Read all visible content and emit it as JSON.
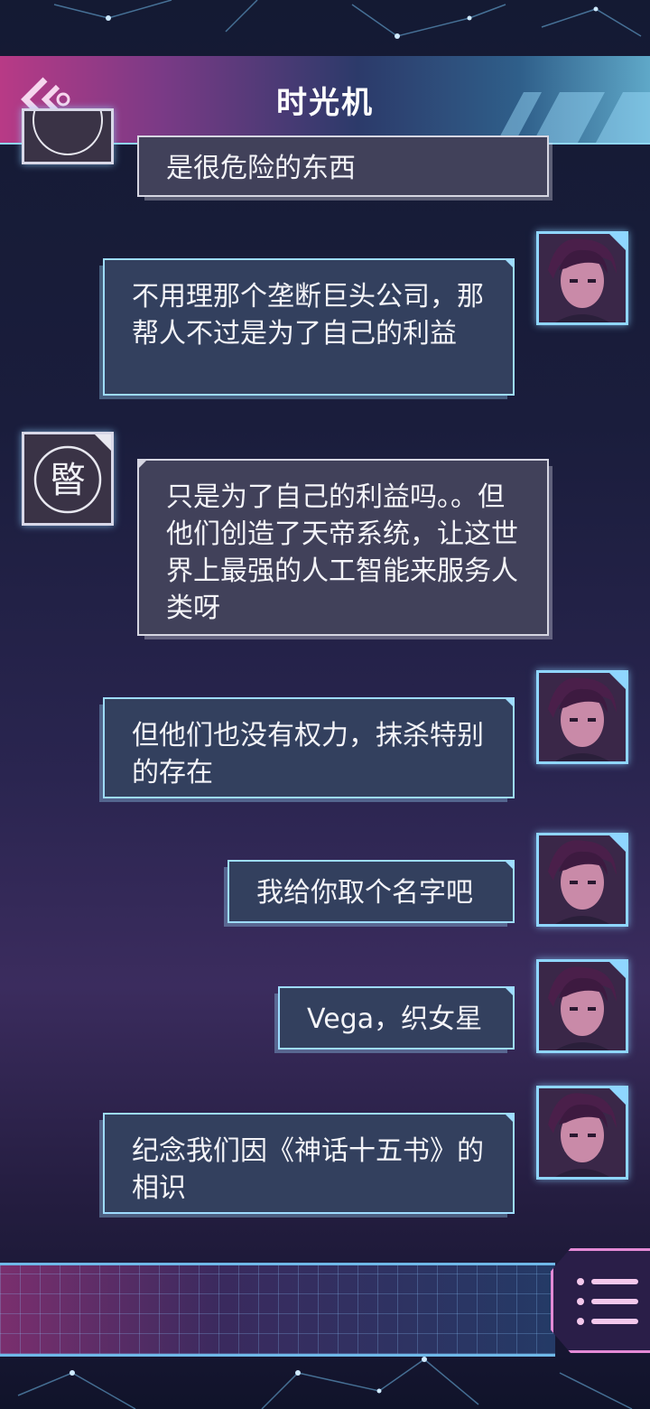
{
  "header": {
    "title": "时光机"
  },
  "messages": [
    {
      "sender": "ai",
      "text": "是很危险的东西"
    },
    {
      "sender": "user",
      "text": "不用理那个垄断巨头公司，那帮人不过是为了自己的利益"
    },
    {
      "sender": "ai",
      "text": "只是为了自己的利益吗。。但他们创造了天帝系统，让这世界上最强的人工智能来服务人类呀"
    },
    {
      "sender": "user",
      "text": "但他们也没有权力，抹杀特别的存在"
    },
    {
      "sender": "user",
      "text": "我给你取个名字吧"
    },
    {
      "sender": "user",
      "text": "Vega，织女星"
    },
    {
      "sender": "user",
      "text": "纪念我们因《神话十五书》的相识"
    }
  ],
  "ai_avatar": {
    "glyph": "暋"
  },
  "icons": {
    "back": "back-chevron-icon",
    "menu": "menu-list-icon"
  },
  "colors": {
    "header_pink": "#b83a86",
    "accent_cyan": "#9edcff",
    "menu_pink": "#e48ad6"
  }
}
